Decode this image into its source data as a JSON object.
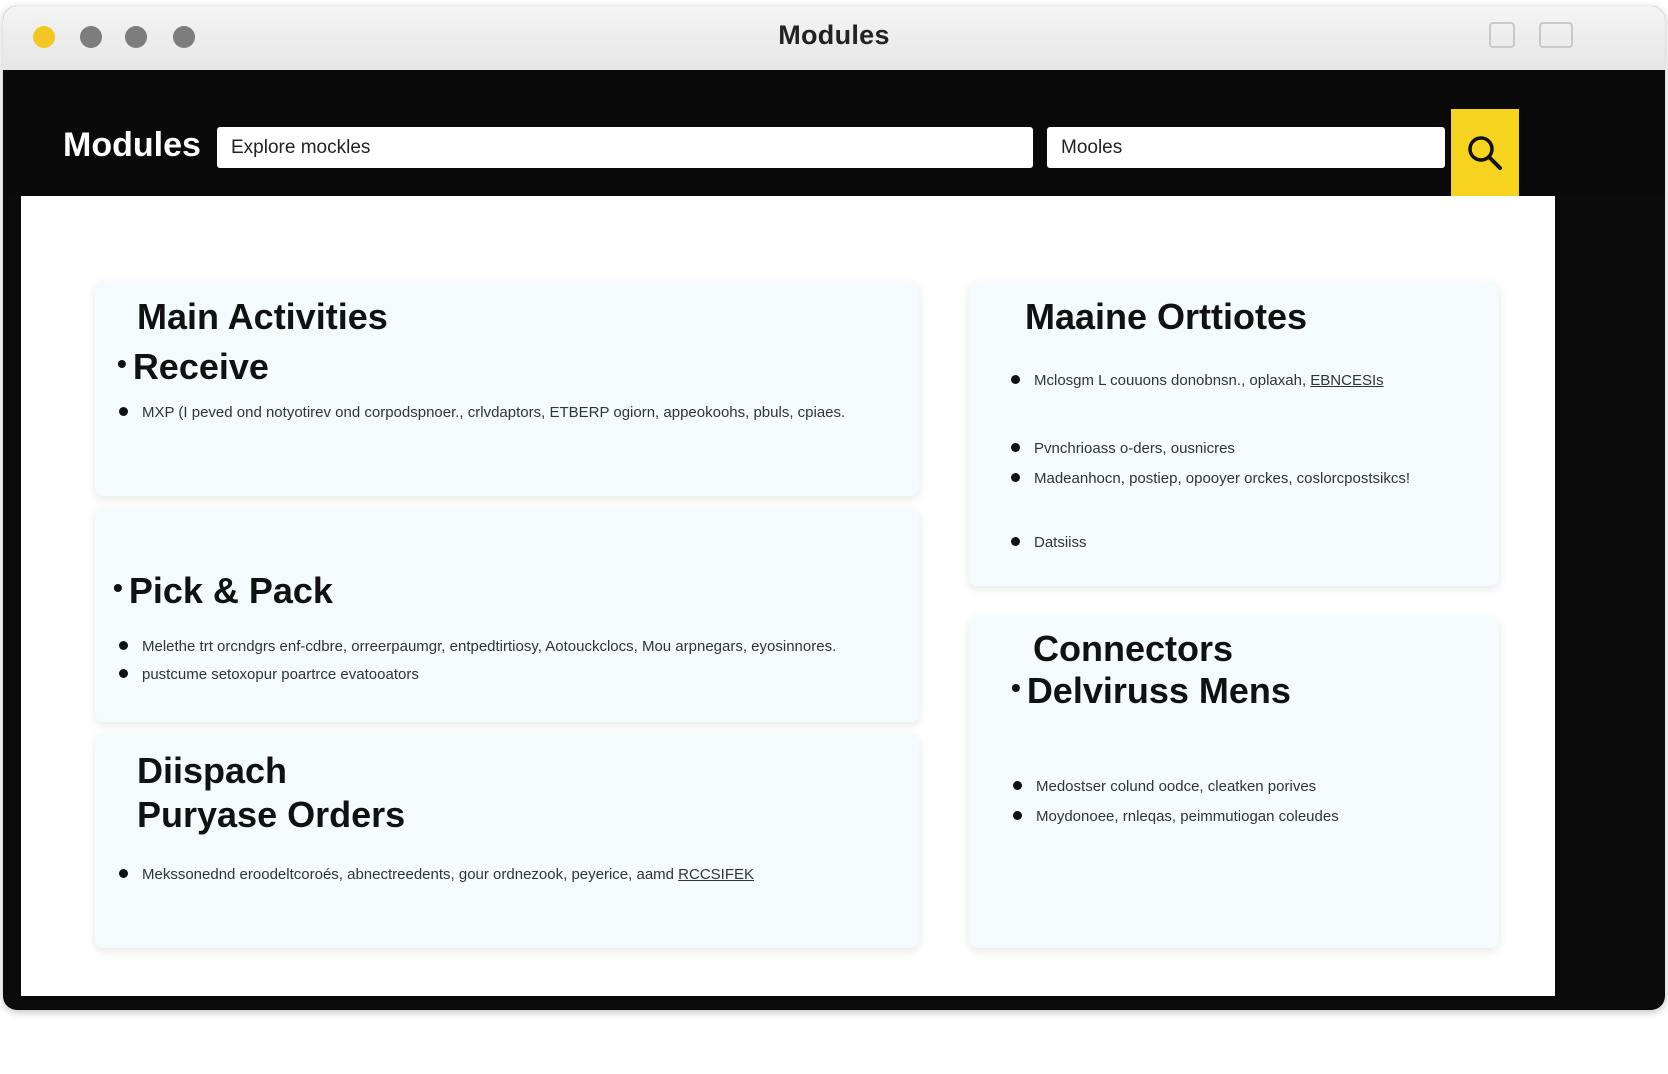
{
  "window": {
    "title": "Modules",
    "accent_color": "#f6d31f"
  },
  "appbar": {
    "title": "Modules",
    "search_value": "Explore mockles",
    "filter_value": "Mooles",
    "search_icon": "search-icon"
  },
  "cards": {
    "main_activities": {
      "heading": "Main Activities",
      "subheading": "Receive",
      "items": [
        "MXP (I peved ond notyotirev ond corpodspnoer., crlvdaptors, ETBERP ogiorn, appeokoohs, pbuls, cpiaes."
      ]
    },
    "pick_pack": {
      "subheading": "Pick & Pack",
      "items": [
        "Melethe trt orcndgrs enf-cdbre, orreerpaumgr, entpedtirtiosy, Aotouckclocs, Mou arpnegars, eyosinnores.",
        "pustcume setoxopur poartrce evatooators"
      ]
    },
    "dispatch": {
      "heading_line1": "Diispach",
      "heading_line2": "Puryase Orders",
      "items": [
        {
          "text": "Mekssonednd eroodeltcoroés, abnectreedents, gour ordnezook, peyerice, aamd ",
          "link": "RCCSIFEK"
        }
      ]
    },
    "maine_orttiotes": {
      "heading": "Maaine Orttiotes",
      "items": [
        {
          "text": "Mclosgm  L  couuons donobnsn., oplaxah, ",
          "link": "EBNCESIs"
        },
        {
          "text": "Pvnchrioass o-ders,  ousnicres",
          "link": ""
        },
        {
          "text": "Madeanhocn, postiep, opooyer orckes, coslorcpostsikcs!",
          "link": ""
        },
        {
          "text": "Datsiiss",
          "link": ""
        }
      ]
    },
    "connectors": {
      "heading": "Connectors",
      "subheading": "Delviruss Mens",
      "items": [
        "Medostser colund oodce,  cleatken porives",
        "Moydonoee, rnleqas, peimmutiogan coleudes"
      ]
    }
  }
}
